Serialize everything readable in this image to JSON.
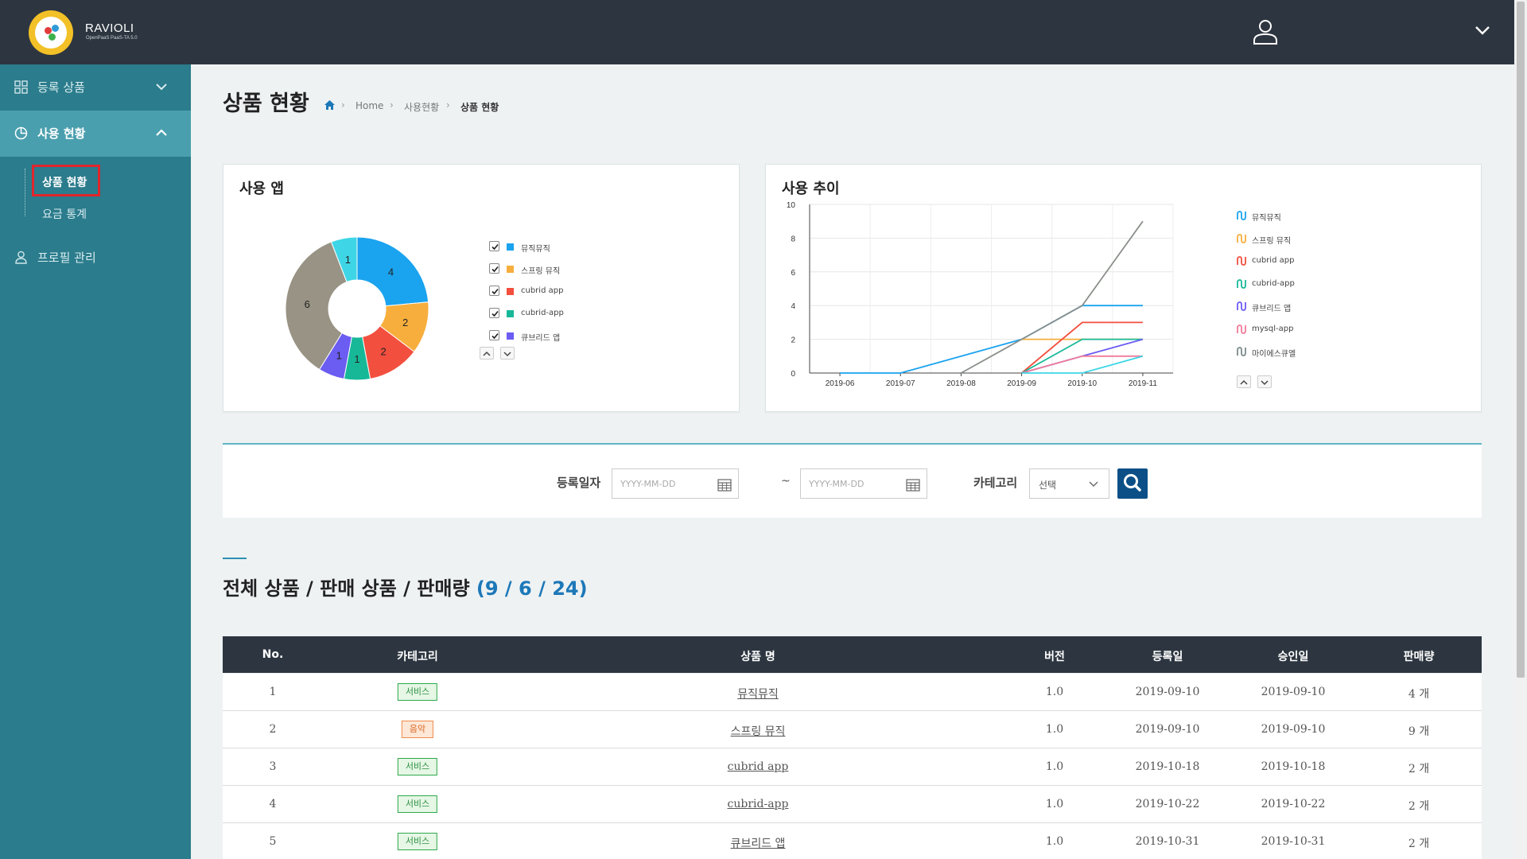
{
  "brand": {
    "name": "RAVIOLI",
    "sub": "OpenPaaS PaaS-TA 5.0"
  },
  "sidebar": {
    "items": [
      {
        "label": "등록 상품",
        "icon": "grid-icon"
      },
      {
        "label": "사용 현황",
        "icon": "pie-icon"
      },
      {
        "label": "프로필 관리",
        "icon": "user-icon"
      }
    ],
    "sub_items": [
      "상품 현황",
      "요금 통계"
    ]
  },
  "page": {
    "title": "상품 현황",
    "breadcrumb": [
      "Home",
      "사용현황",
      "상품 현황"
    ]
  },
  "usage_app": {
    "title": "사용 앱",
    "legend": [
      {
        "label": "뮤직뮤직",
        "color": "#1aa3ee"
      },
      {
        "label": "스프링 뮤직",
        "color": "#f7ae3c"
      },
      {
        "label": "cubrid app",
        "color": "#f24f3f"
      },
      {
        "label": "cubrid-app",
        "color": "#17b898"
      },
      {
        "label": "큐브리드 앱",
        "color": "#6b5cf2"
      }
    ]
  },
  "usage_trend": {
    "title": "사용 추이",
    "legend": [
      {
        "label": "뮤직뮤직",
        "color": "#1aa3ee"
      },
      {
        "label": "스프링 뮤직",
        "color": "#f7ae3c"
      },
      {
        "label": "cubrid app",
        "color": "#f24f3f"
      },
      {
        "label": "cubrid-app",
        "color": "#17b898"
      },
      {
        "label": "큐브리드 앱",
        "color": "#6b5cf2"
      },
      {
        "label": "mysql-app",
        "color": "#f07c9a"
      },
      {
        "label": "마이에스큐엘",
        "color": "#7b8a8a"
      }
    ]
  },
  "chart_data": [
    {
      "type": "pie",
      "title": "사용 앱",
      "donut": true,
      "slices": [
        {
          "name": "뮤직뮤직",
          "value": 4,
          "color": "#1aa3ee"
        },
        {
          "name": "스프링 뮤직",
          "value": 2,
          "color": "#f7ae3c"
        },
        {
          "name": "cubrid app",
          "value": 2,
          "color": "#f24f3f"
        },
        {
          "name": "cubrid-app",
          "value": 1,
          "color": "#17b898"
        },
        {
          "name": "큐브리드 앱",
          "value": 1,
          "color": "#6b5cf2"
        },
        {
          "name": "",
          "value": 6,
          "color": "#989384"
        },
        {
          "name": "",
          "value": 1,
          "color": "#3ed6e6"
        }
      ]
    },
    {
      "type": "line",
      "title": "사용 추이",
      "x": [
        "2019-06",
        "2019-07",
        "2019-08",
        "2019-09",
        "2019-10",
        "2019-11"
      ],
      "ylim": [
        0,
        10
      ],
      "yticks": [
        0,
        2,
        4,
        6,
        8,
        10
      ],
      "grid": true,
      "legend_position": "right",
      "series": [
        {
          "name": "뮤직뮤직",
          "color": "#1aa3ee",
          "points": [
            [
              0,
              0
            ],
            [
              1,
              0
            ],
            [
              3,
              2
            ],
            [
              4,
              4
            ],
            [
              5,
              4
            ]
          ]
        },
        {
          "name": "스프링 뮤직",
          "color": "#f7ae3c",
          "points": [
            [
              3,
              2
            ],
            [
              3.9,
              2
            ],
            [
              5,
              2
            ]
          ]
        },
        {
          "name": "cubrid app",
          "color": "#f24f3f",
          "points": [
            [
              3,
              0
            ],
            [
              4,
              3
            ],
            [
              5,
              3
            ]
          ]
        },
        {
          "name": "cubrid-app",
          "color": "#17b898",
          "points": [
            [
              3,
              0
            ],
            [
              4,
              2
            ],
            [
              5,
              2
            ]
          ]
        },
        {
          "name": "큐브리드 앱",
          "color": "#6b5cf2",
          "points": [
            [
              3,
              0
            ],
            [
              4,
              1
            ],
            [
              5,
              2
            ]
          ]
        },
        {
          "name": "mysql-app",
          "color": "#f07c9a",
          "points": [
            [
              3,
              0
            ],
            [
              4,
              1
            ],
            [
              5,
              1
            ]
          ]
        },
        {
          "name": "마이에스큐엘",
          "color": "#3ed6e6",
          "points": [
            [
              3,
              0
            ],
            [
              4,
              0
            ],
            [
              5,
              1
            ]
          ]
        },
        {
          "name": "",
          "color": "#8a8f8a",
          "points": [
            [
              2,
              0
            ],
            [
              3,
              2
            ],
            [
              4,
              4
            ],
            [
              5,
              9
            ]
          ]
        }
      ]
    }
  ],
  "search": {
    "date_label": "등록일자",
    "date_from_placeholder": "YYYY-MM-DD",
    "date_to_placeholder": "YYYY-MM-DD",
    "tilde": "~",
    "category_label": "카테고리",
    "category_value": "선택"
  },
  "summary": {
    "label": "전체 상품 / 판매 상품 / 판매량",
    "counts": "(9 / 6 / 24)"
  },
  "table": {
    "headers": [
      "No.",
      "카테고리",
      "상품 명",
      "버전",
      "등록일",
      "승인일",
      "판매량"
    ],
    "rows": [
      {
        "no": "1",
        "category": "서비스",
        "name": "뮤직뮤직",
        "version": "1.0",
        "reg": "2019-09-10",
        "appr": "2019-09-10",
        "sales": "4 개"
      },
      {
        "no": "2",
        "category": "음악",
        "name": "스프링 뮤직",
        "version": "1.0",
        "reg": "2019-09-10",
        "appr": "2019-09-10",
        "sales": "9 개"
      },
      {
        "no": "3",
        "category": "서비스",
        "name": "cubrid app",
        "version": "1.0",
        "reg": "2019-10-18",
        "appr": "2019-10-18",
        "sales": "2 개"
      },
      {
        "no": "4",
        "category": "서비스",
        "name": "cubrid-app",
        "version": "1.0",
        "reg": "2019-10-22",
        "appr": "2019-10-22",
        "sales": "2 개"
      },
      {
        "no": "5",
        "category": "서비스",
        "name": "큐브리드 앱",
        "version": "1.0",
        "reg": "2019-10-31",
        "appr": "2019-10-31",
        "sales": "2 개"
      }
    ]
  }
}
